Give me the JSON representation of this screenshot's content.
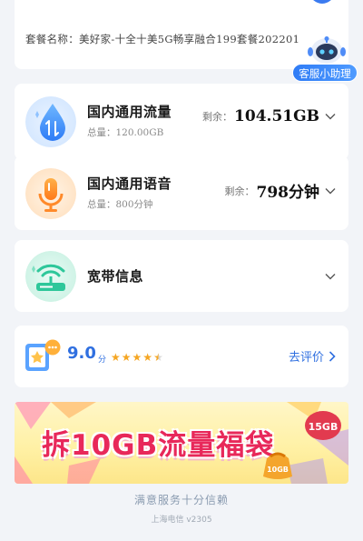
{
  "plan": {
    "name_label": "套餐名称：美好家-十全十美5G畅享融合199套餐202201"
  },
  "assistant": {
    "label": "客服小助理"
  },
  "usage": [
    {
      "title": "国内通用流量",
      "total": "总量：120.00GB",
      "remain_label": "剩余：",
      "remain_value": "104.51GB",
      "icon": "water-drop-data-icon"
    },
    {
      "title": "国内通用语音",
      "total": "总量：800分钟",
      "remain_label": "剩余：",
      "remain_value": "798分钟",
      "icon": "microphone-icon"
    }
  ],
  "broadband": {
    "title": "宽带信息",
    "icon": "wifi-router-icon"
  },
  "rating": {
    "value": "9.0",
    "unit": "分",
    "stars": 4.5,
    "link": "去评价"
  },
  "banner": {
    "text": "拆10GB流量福袋",
    "badge": "15GB",
    "bag_label": "10GB"
  },
  "footer": {
    "slogan": "满意服务十分信赖",
    "version": "上海电信 v2305"
  },
  "colors": {
    "accent": "#2f6fe0",
    "banner_text": "#e8285a",
    "star": "#f5a623"
  }
}
